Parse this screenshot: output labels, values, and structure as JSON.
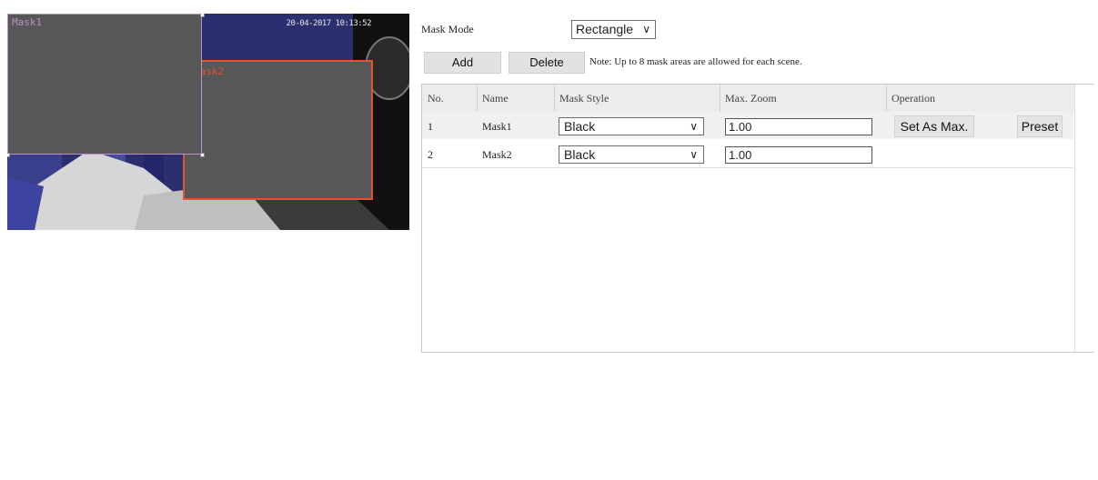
{
  "preview": {
    "osd_time": "20-04-2017 10:13:52",
    "masks": [
      {
        "label": "Mask1",
        "color": "#b990c8"
      },
      {
        "label": "Mask2",
        "color": "#e2542e"
      }
    ]
  },
  "controls": {
    "mask_mode_label": "Mask Mode",
    "mask_mode_value": "Rectangle",
    "add_label": "Add",
    "delete_label": "Delete",
    "note": "Note: Up to 8 mask areas are allowed for each scene."
  },
  "table": {
    "headers": [
      "No.",
      "Name",
      "Mask Style",
      "Max. Zoom",
      "Operation"
    ],
    "rows": [
      {
        "no": "1",
        "name": "Mask1",
        "style": "Black",
        "zoom": "1.00",
        "set_max": "Set As Max.",
        "preset": "Preset"
      },
      {
        "no": "2",
        "name": "Mask2",
        "style": "Black",
        "zoom": "1.00"
      }
    ]
  },
  "icons": {
    "dropdown": "chevron-down-icon"
  },
  "colors": {
    "header_bg": "#ececec",
    "button_bg": "#e2e2e2",
    "mask_fill": "#575757"
  }
}
